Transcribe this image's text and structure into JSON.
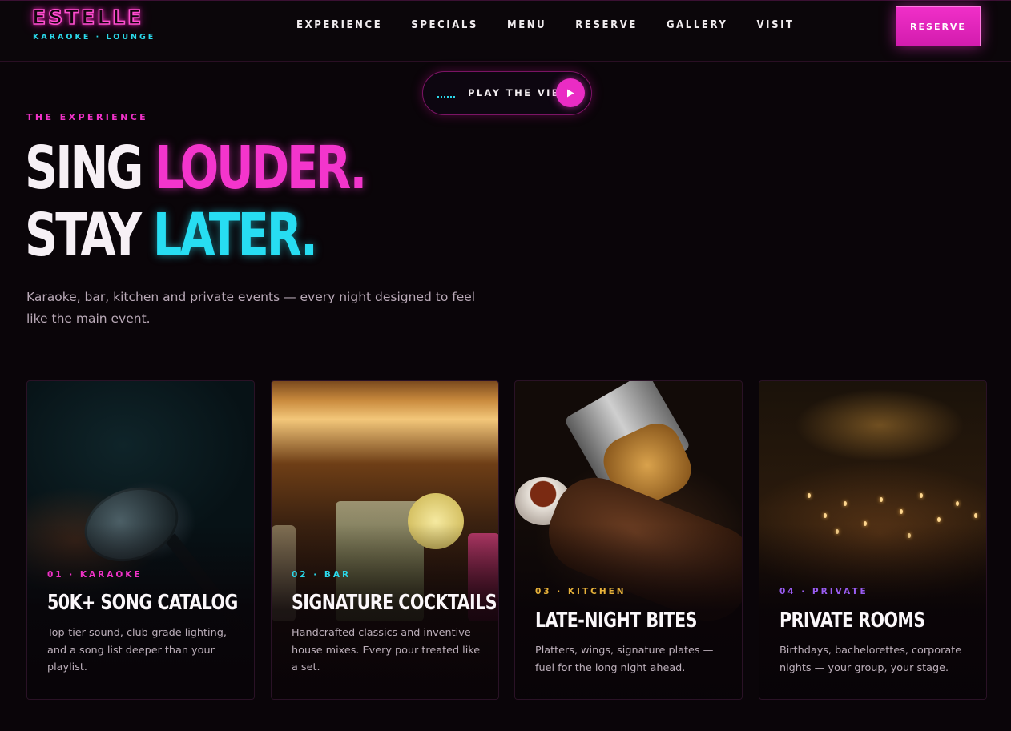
{
  "brand": {
    "name": "ESTELLE",
    "tagline": "KARAOKE · LOUNGE"
  },
  "nav": {
    "items": [
      "EXPERIENCE",
      "SPECIALS",
      "MENU",
      "RESERVE",
      "GALLERY",
      "VISIT"
    ]
  },
  "header": {
    "reserve_label": "RESERVE"
  },
  "player": {
    "label": "PLAY THE VIBE",
    "icon": "play-icon"
  },
  "hero": {
    "eyebrow": "THE EXPERIENCE",
    "line1_a": "SING ",
    "line1_b": "LOUDER.",
    "line2_a": "STAY ",
    "line2_b": "LATER.",
    "lede": "Karaoke, bar, kitchen and private events — every night designed to feel like the main event."
  },
  "cards": [
    {
      "tag": "01 · KARAOKE",
      "title": "50K+ SONG CATALOG",
      "desc": "Top-tier sound, club-grade lighting, and a song list deeper than your playlist.",
      "tag_color": "#f032c8"
    },
    {
      "tag": "02 · BAR",
      "title": "SIGNATURE COCKTAILS",
      "desc": "Handcrafted classics and inventive house mixes. Every pour treated like a set.",
      "tag_color": "#2bd8ea"
    },
    {
      "tag": "03 · KITCHEN",
      "title": "LATE-NIGHT BITES",
      "desc": "Platters, wings, signature plates — fuel for the long night ahead.",
      "tag_color": "#e8b23a"
    },
    {
      "tag": "04 · PRIVATE",
      "title": "PRIVATE ROOMS",
      "desc": "Birthdays, bachelorettes, corporate nights — your group, your stage.",
      "tag_color": "#9a5cf2"
    }
  ],
  "colors": {
    "accent_pink": "#f032c8",
    "accent_cyan": "#2bd8ea",
    "background": "#0a0509"
  }
}
